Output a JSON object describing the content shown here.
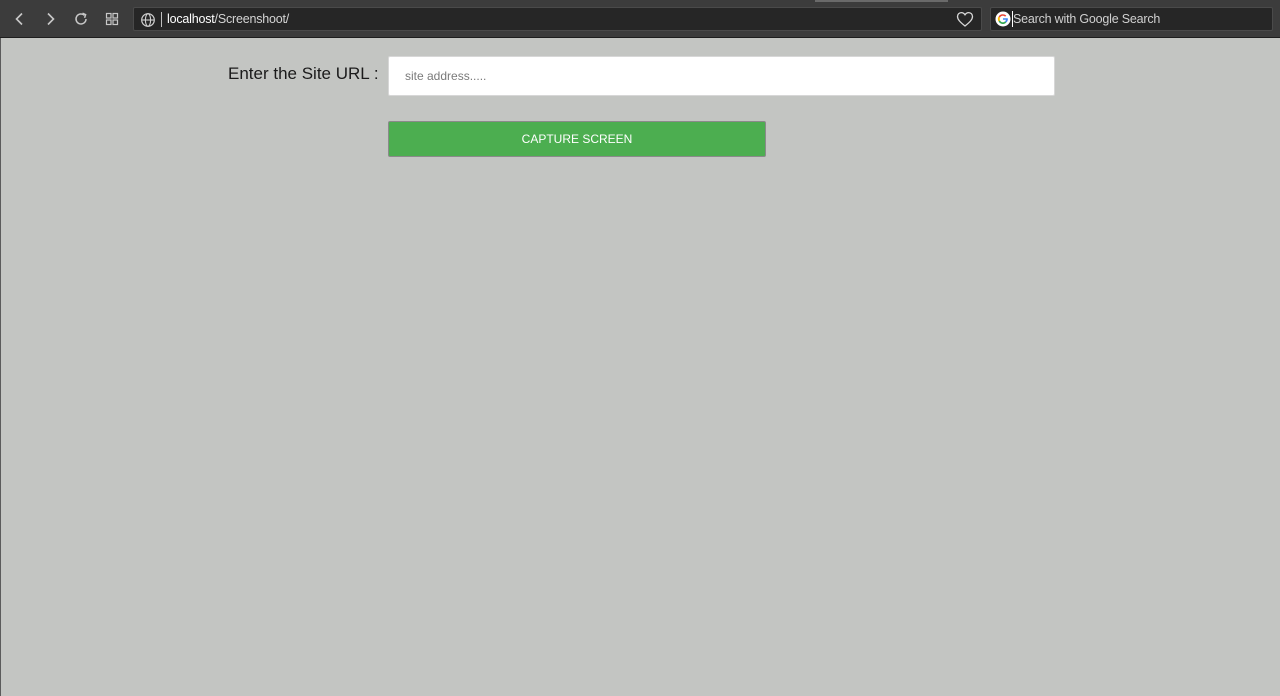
{
  "browser": {
    "address": {
      "host": "localhost",
      "path": "/Screenshoot/"
    },
    "search": {
      "placeholder": "Search with Google Search"
    },
    "icons": [
      "back-icon",
      "forward-icon",
      "reload-icon",
      "speed-dial-icon",
      "globe-icon",
      "heart-icon",
      "google-icon"
    ]
  },
  "form": {
    "label": "Enter the Site URL :",
    "input_placeholder": "site address.....",
    "input_value": "",
    "button_label": "CAPTURE SCREEN"
  },
  "colors": {
    "page_background": "#c3c5c2",
    "button_green": "#4cae50",
    "toolbar": "#3c3c3c"
  }
}
